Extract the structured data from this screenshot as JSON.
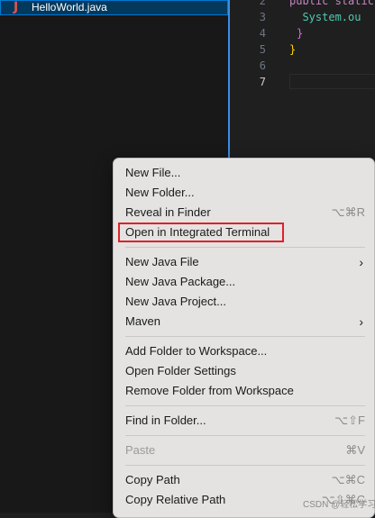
{
  "explorer": {
    "file_icon_glyph": "J",
    "file_name": "HelloWorld.java"
  },
  "editor": {
    "lines": [
      {
        "num": "2",
        "code": "public static"
      },
      {
        "num": "3",
        "code": "  System.ou"
      },
      {
        "num": "4",
        "code": "}"
      },
      {
        "num": "5",
        "code": "}"
      },
      {
        "num": "6",
        "code": ""
      },
      {
        "num": "7",
        "code": ""
      }
    ]
  },
  "context_menu": {
    "new_file": "New File...",
    "new_folder": "New Folder...",
    "reveal_in_finder": "Reveal in Finder",
    "reveal_in_finder_shortcut": "⌥⌘R",
    "open_in_terminal": "Open in Integrated Terminal",
    "new_java_file": "New Java File",
    "new_java_package": "New Java Package...",
    "new_java_project": "New Java Project...",
    "maven": "Maven",
    "add_folder_to_workspace": "Add Folder to Workspace...",
    "open_folder_settings": "Open Folder Settings",
    "remove_folder_from_workspace": "Remove Folder from Workspace",
    "find_in_folder": "Find in Folder...",
    "find_in_folder_shortcut": "⌥⇧F",
    "paste": "Paste",
    "paste_shortcut": "⌘V",
    "copy_path": "Copy Path",
    "copy_path_shortcut": "⌥⌘C",
    "copy_relative_path": "Copy Relative Path",
    "copy_relative_path_shortcut": "⌥⇧⌘C"
  },
  "watermark": "CSDN @轻松学习",
  "colors": {
    "highlight_border": "#e0202a",
    "selection_bg": "#04395e",
    "keyword": "#c586c0",
    "type": "#4ec9b0",
    "brace_yellow": "#ffd700",
    "brace_purple": "#da70d6"
  }
}
